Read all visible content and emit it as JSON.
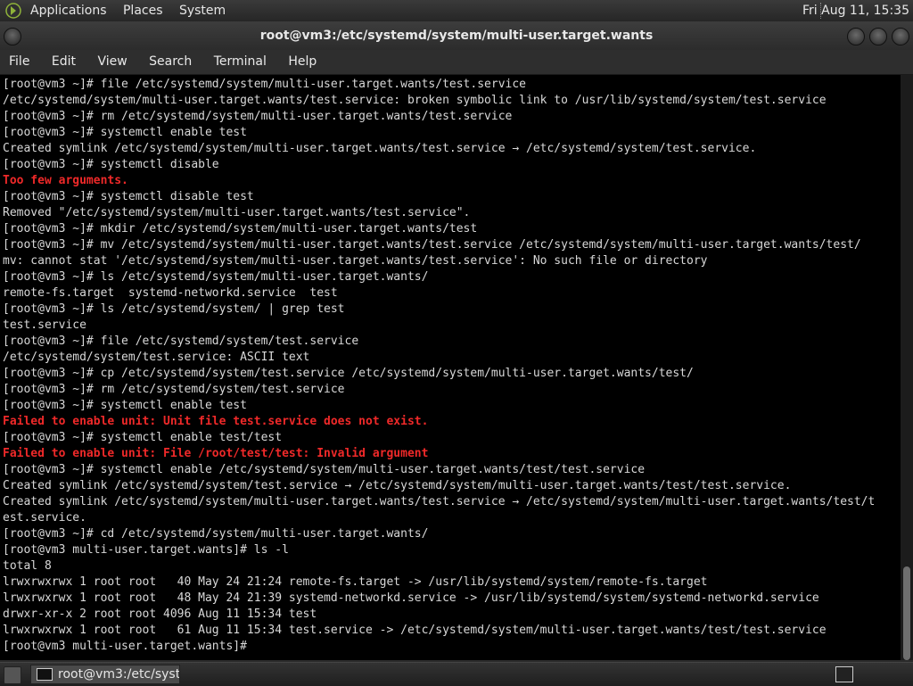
{
  "panel": {
    "menus": [
      "Applications",
      "Places",
      "System"
    ],
    "clock": "Fri Aug 11, 15:35"
  },
  "window": {
    "title": "root@vm3:/etc/systemd/system/multi-user.target.wants"
  },
  "menubar": {
    "items": [
      "File",
      "Edit",
      "View",
      "Search",
      "Terminal",
      "Help"
    ]
  },
  "terminal": {
    "lines": [
      {
        "text": "[root@vm3 ~]# file /etc/systemd/system/multi-user.target.wants/test.service",
        "type": "normal"
      },
      {
        "text": "/etc/systemd/system/multi-user.target.wants/test.service: broken symbolic link to /usr/lib/systemd/system/test.service",
        "type": "normal"
      },
      {
        "text": "[root@vm3 ~]# rm /etc/systemd/system/multi-user.target.wants/test.service",
        "type": "normal"
      },
      {
        "text": "[root@vm3 ~]# systemctl enable test",
        "type": "normal"
      },
      {
        "text": "Created symlink /etc/systemd/system/multi-user.target.wants/test.service → /etc/systemd/system/test.service.",
        "type": "normal"
      },
      {
        "text": "[root@vm3 ~]# systemctl disable",
        "type": "normal"
      },
      {
        "text": "Too few arguments.",
        "type": "error"
      },
      {
        "text": "[root@vm3 ~]# systemctl disable test",
        "type": "normal"
      },
      {
        "text": "Removed \"/etc/systemd/system/multi-user.target.wants/test.service\".",
        "type": "normal"
      },
      {
        "text": "[root@vm3 ~]# mkdir /etc/systemd/system/multi-user.target.wants/test",
        "type": "normal"
      },
      {
        "text": "[root@vm3 ~]# mv /etc/systemd/system/multi-user.target.wants/test.service /etc/systemd/system/multi-user.target.wants/test/",
        "type": "normal"
      },
      {
        "text": "mv: cannot stat '/etc/systemd/system/multi-user.target.wants/test.service': No such file or directory",
        "type": "normal"
      },
      {
        "text": "[root@vm3 ~]# ls /etc/systemd/system/multi-user.target.wants/",
        "type": "normal"
      },
      {
        "text": "remote-fs.target  systemd-networkd.service  test",
        "type": "normal"
      },
      {
        "text": "[root@vm3 ~]# ls /etc/systemd/system/ | grep test",
        "type": "normal"
      },
      {
        "text": "test.service",
        "type": "normal"
      },
      {
        "text": "[root@vm3 ~]# file /etc/systemd/system/test.service",
        "type": "normal"
      },
      {
        "text": "/etc/systemd/system/test.service: ASCII text",
        "type": "normal"
      },
      {
        "text": "[root@vm3 ~]# cp /etc/systemd/system/test.service /etc/systemd/system/multi-user.target.wants/test/",
        "type": "normal"
      },
      {
        "text": "[root@vm3 ~]# rm /etc/systemd/system/test.service",
        "type": "normal"
      },
      {
        "text": "[root@vm3 ~]# systemctl enable test",
        "type": "normal"
      },
      {
        "text": "Failed to enable unit: Unit file test.service does not exist.",
        "type": "error"
      },
      {
        "text": "[root@vm3 ~]# systemctl enable test/test",
        "type": "normal"
      },
      {
        "text": "Failed to enable unit: File /root/test/test: Invalid argument",
        "type": "error"
      },
      {
        "text": "[root@vm3 ~]# systemctl enable /etc/systemd/system/multi-user.target.wants/test/test.service",
        "type": "normal"
      },
      {
        "text": "Created symlink /etc/systemd/system/test.service → /etc/systemd/system/multi-user.target.wants/test/test.service.",
        "type": "normal"
      },
      {
        "text": "Created symlink /etc/systemd/system/multi-user.target.wants/test.service → /etc/systemd/system/multi-user.target.wants/test/t",
        "type": "normal"
      },
      {
        "text": "est.service.",
        "type": "normal"
      },
      {
        "text": "[root@vm3 ~]# cd /etc/systemd/system/multi-user.target.wants/",
        "type": "normal"
      },
      {
        "text": "[root@vm3 multi-user.target.wants]# ls -l",
        "type": "normal"
      },
      {
        "text": "total 8",
        "type": "normal"
      },
      {
        "text": "lrwxrwxrwx 1 root root   40 May 24 21:24 remote-fs.target -> /usr/lib/systemd/system/remote-fs.target",
        "type": "normal"
      },
      {
        "text": "lrwxrwxrwx 1 root root   48 May 24 21:39 systemd-networkd.service -> /usr/lib/systemd/system/systemd-networkd.service",
        "type": "normal"
      },
      {
        "text": "drwxr-xr-x 2 root root 4096 Aug 11 15:34 test",
        "type": "normal"
      },
      {
        "text": "lrwxrwxrwx 1 root root   61 Aug 11 15:34 test.service -> /etc/systemd/system/multi-user.target.wants/test/test.service",
        "type": "normal"
      },
      {
        "text": "[root@vm3 multi-user.target.wants]# ",
        "type": "normal"
      }
    ]
  },
  "scrollbar": {
    "position_fraction": 0.84,
    "visible_fraction": 0.16
  },
  "taskbar": {
    "task_label": "root@vm3:/etc/syst..."
  },
  "colors": {
    "terminal_bg": "#000000",
    "terminal_fg": "#d8d8d8",
    "error_fg": "#ef2929"
  }
}
